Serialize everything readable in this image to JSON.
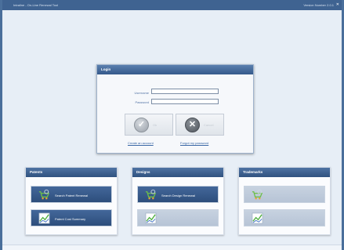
{
  "window": {
    "title": "Intraline - On-Line Renewal Tool",
    "version": "Version Number 2.0.1",
    "close_glyph": "✕"
  },
  "login": {
    "title": "Login",
    "username_label": "Username",
    "password_label": "Password",
    "username_value": "",
    "password_value": "",
    "ok_label": "Ok",
    "cancel_label": "Cancel",
    "ok_glyph": "✓",
    "cancel_glyph": "✕",
    "create_account": "Create an account",
    "forgot_password": "Forgot my password"
  },
  "panels": [
    {
      "title": "Patents",
      "tiles": [
        {
          "label": "Search Patent Renewal",
          "icon": "cart-search-icon",
          "enabled": true
        },
        {
          "label": "Patent Cost Summary",
          "icon": "chart-icon",
          "enabled": true
        }
      ]
    },
    {
      "title": "Designs",
      "tiles": [
        {
          "label": "Search Design Renewal",
          "icon": "cart-search-icon",
          "enabled": true
        },
        {
          "label": "",
          "icon": "chart-icon",
          "enabled": false
        }
      ]
    },
    {
      "title": "Trademarks",
      "tiles": [
        {
          "label": "",
          "icon": "cart-search-icon",
          "enabled": false
        },
        {
          "label": "",
          "icon": "chart-icon",
          "enabled": false
        }
      ]
    }
  ],
  "colors": {
    "accent": "#3f6391",
    "background": "#e7eef6",
    "link": "#3a68a6"
  }
}
